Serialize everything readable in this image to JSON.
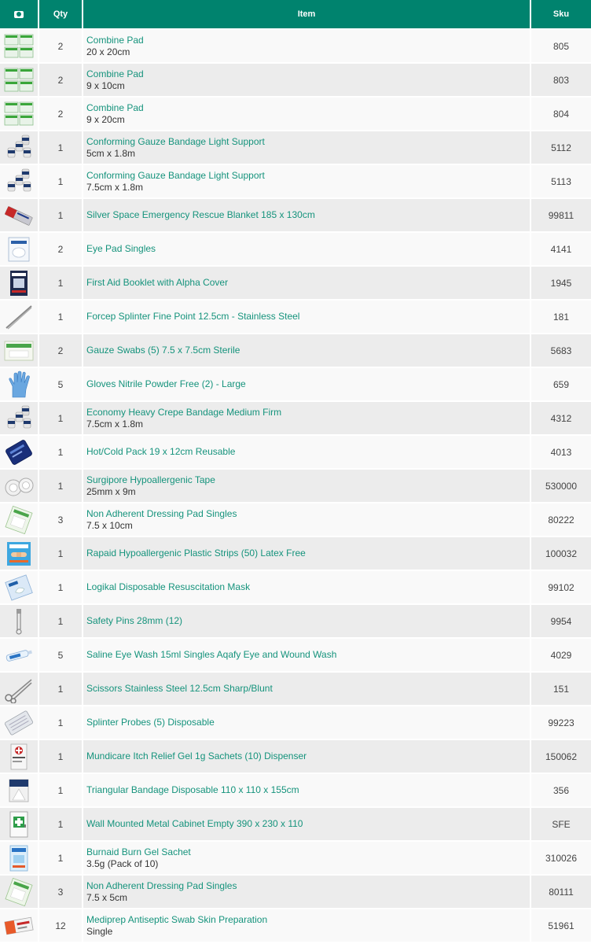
{
  "header": {
    "photo_icon": "camera-icon",
    "qty_label": "Qty",
    "item_label": "Item",
    "sku_label": "Sku"
  },
  "colors": {
    "header_bg": "#00836e",
    "link": "#15937c",
    "row_odd": "#f9f9f9",
    "row_even": "#ececec"
  },
  "rows": [
    {
      "qty": "2",
      "name": "Combine Pad",
      "spec": "20 x 20cm",
      "sku": "805",
      "thumb": "combine-pad-icon"
    },
    {
      "qty": "2",
      "name": "Combine Pad",
      "spec": "9 x 10cm",
      "sku": "803",
      "thumb": "combine-pad-icon"
    },
    {
      "qty": "2",
      "name": "Combine Pad",
      "spec": "9 x 20cm",
      "sku": "804",
      "thumb": "combine-pad-icon"
    },
    {
      "qty": "1",
      "name": "Conforming Gauze Bandage Light Support",
      "spec": "5cm x 1.8m",
      "sku": "5112",
      "thumb": "bandage-rolls-icon"
    },
    {
      "qty": "1",
      "name": "Conforming Gauze Bandage Light Support",
      "spec": "7.5cm x 1.8m",
      "sku": "5113",
      "thumb": "bandage-rolls-icon"
    },
    {
      "qty": "1",
      "name": "Silver Space Emergency Rescue Blanket 185 x 130cm",
      "spec": "",
      "sku": "99811",
      "thumb": "blanket-icon"
    },
    {
      "qty": "2",
      "name": "Eye Pad Singles",
      "spec": "",
      "sku": "4141",
      "thumb": "eye-pad-icon"
    },
    {
      "qty": "1",
      "name": "First Aid Booklet with Alpha Cover",
      "spec": "",
      "sku": "1945",
      "thumb": "booklet-icon"
    },
    {
      "qty": "1",
      "name": "Forcep Splinter Fine Point 12.5cm - Stainless Steel",
      "spec": "",
      "sku": "181",
      "thumb": "forcep-icon"
    },
    {
      "qty": "2",
      "name": "Gauze Swabs (5) 7.5 x 7.5cm Sterile",
      "spec": "",
      "sku": "5683",
      "thumb": "gauze-swab-icon"
    },
    {
      "qty": "5",
      "name": "Gloves Nitrile Powder Free (2) - Large",
      "spec": "",
      "sku": "659",
      "thumb": "glove-icon"
    },
    {
      "qty": "1",
      "name": "Economy Heavy Crepe Bandage Medium Firm",
      "spec": "7.5cm x 1.8m",
      "sku": "4312",
      "thumb": "bandage-rolls-icon"
    },
    {
      "qty": "1",
      "name": "Hot/Cold Pack 19 x 12cm Reusable",
      "spec": "",
      "sku": "4013",
      "thumb": "cold-pack-icon"
    },
    {
      "qty": "1",
      "name": "Surgipore Hypoallergenic Tape",
      "spec": "25mm x 9m",
      "sku": "530000",
      "thumb": "tape-icon"
    },
    {
      "qty": "3",
      "name": "Non Adherent Dressing Pad Singles",
      "spec": "7.5 x 10cm",
      "sku": "80222",
      "thumb": "dressing-pad-icon"
    },
    {
      "qty": "1",
      "name": "Rapaid Hypoallergenic Plastic Strips (50) Latex Free",
      "spec": "",
      "sku": "100032",
      "thumb": "plastic-strips-icon"
    },
    {
      "qty": "1",
      "name": "Logikal Disposable Resuscitation Mask",
      "spec": "",
      "sku": "99102",
      "thumb": "resus-mask-icon"
    },
    {
      "qty": "1",
      "name": "Safety Pins 28mm (12)",
      "spec": "",
      "sku": "9954",
      "thumb": "safety-pin-icon"
    },
    {
      "qty": "5",
      "name": "Saline Eye Wash 15ml Singles Aqafy Eye and Wound Wash",
      "spec": "",
      "sku": "4029",
      "thumb": "eye-wash-icon"
    },
    {
      "qty": "1",
      "name": "Scissors Stainless Steel 12.5cm Sharp/Blunt",
      "spec": "",
      "sku": "151",
      "thumb": "scissors-icon"
    },
    {
      "qty": "1",
      "name": "Splinter Probes (5) Disposable",
      "spec": "",
      "sku": "99223",
      "thumb": "splinter-probes-icon"
    },
    {
      "qty": "1",
      "name": "Mundicare Itch Relief Gel 1g Sachets (10) Dispenser",
      "spec": "",
      "sku": "150062",
      "thumb": "gel-dispenser-icon"
    },
    {
      "qty": "1",
      "name": "Triangular Bandage Disposable 110 x 110 x 155cm",
      "spec": "",
      "sku": "356",
      "thumb": "triangular-bandage-icon"
    },
    {
      "qty": "1",
      "name": "Wall Mounted Metal Cabinet Empty 390 x 230 x 110",
      "spec": "",
      "sku": "SFE",
      "thumb": "cabinet-icon"
    },
    {
      "qty": "1",
      "name": "Burnaid Burn Gel Sachet",
      "spec": "3.5g (Pack of 10)",
      "sku": "310026",
      "thumb": "burn-gel-icon"
    },
    {
      "qty": "3",
      "name": "Non Adherent Dressing Pad Singles",
      "spec": "7.5 x 5cm",
      "sku": "80111",
      "thumb": "dressing-pad-icon"
    },
    {
      "qty": "12",
      "name": "Mediprep Antiseptic Swab Skin Preparation",
      "spec": "Single",
      "sku": "51961",
      "thumb": "antiseptic-swab-icon"
    }
  ]
}
